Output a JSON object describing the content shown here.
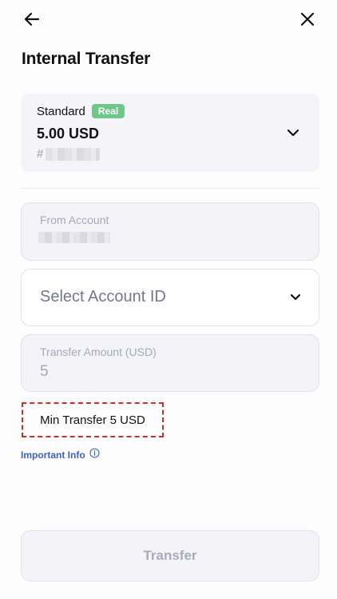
{
  "header": {
    "back_icon": "arrow-left-icon",
    "close_icon": "close-icon",
    "title": "Internal Transfer"
  },
  "account_card": {
    "type": "Standard",
    "badge": "Real",
    "balance": "5.00 USD",
    "number_prefix": "#",
    "number_state": "blurred",
    "chevron_icon": "chevron-down-icon"
  },
  "from_account": {
    "label": "From Account",
    "value_state": "blurred"
  },
  "select_account": {
    "placeholder": "Select Account ID",
    "chevron_icon": "chevron-down-icon"
  },
  "amount": {
    "label": "Transfer Amount (USD)",
    "value": "5"
  },
  "notice": {
    "min_transfer": "Min Transfer 5 USD"
  },
  "important_info": {
    "label": "Important Info",
    "icon": "info-icon"
  },
  "footer": {
    "transfer_label": "Transfer"
  },
  "colors": {
    "badge": "#6cc98a",
    "link": "#3a62c4",
    "highlight_border": "#d12c2c",
    "muted_text": "#a7a8b8"
  }
}
